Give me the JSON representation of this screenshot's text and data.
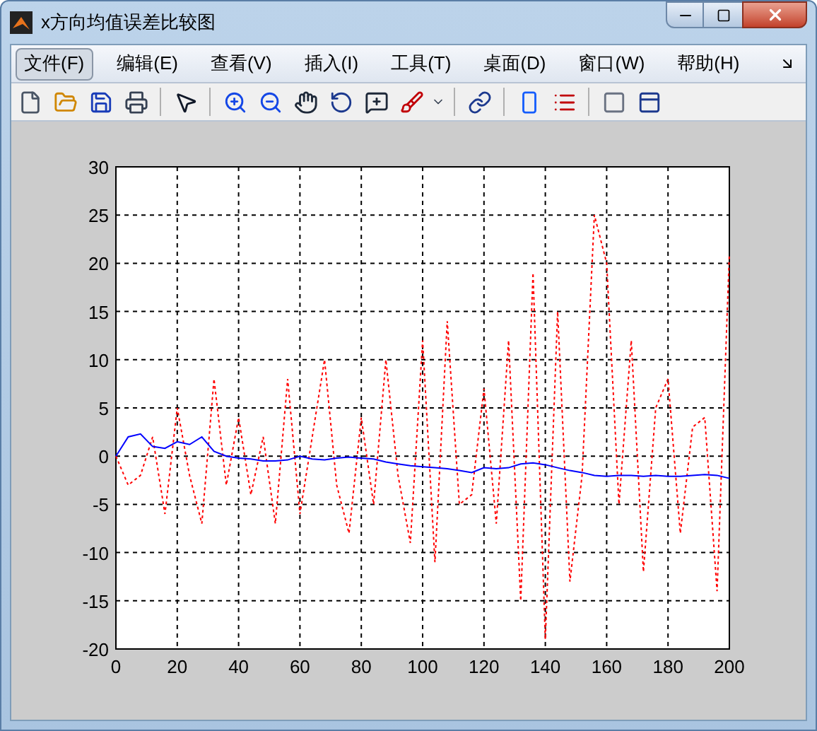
{
  "window": {
    "title": "x方向均值误差比较图"
  },
  "menu": [
    {
      "label": "文件(F)",
      "selected": true
    },
    {
      "label": "编辑(E)",
      "selected": false
    },
    {
      "label": "查看(V)",
      "selected": false
    },
    {
      "label": "插入(I)",
      "selected": false
    },
    {
      "label": "工具(T)",
      "selected": false
    },
    {
      "label": "桌面(D)",
      "selected": false
    },
    {
      "label": "窗口(W)",
      "selected": false
    },
    {
      "label": "帮助(H)",
      "selected": false
    }
  ],
  "figure": {
    "chart_data": {
      "type": "line",
      "x": [
        0,
        4,
        8,
        12,
        16,
        20,
        24,
        28,
        32,
        36,
        40,
        44,
        48,
        52,
        56,
        60,
        64,
        68,
        72,
        76,
        80,
        84,
        88,
        92,
        96,
        100,
        104,
        108,
        112,
        116,
        120,
        124,
        128,
        132,
        136,
        140,
        144,
        148,
        152,
        156,
        160,
        164,
        168,
        172,
        176,
        180,
        184,
        188,
        192,
        196,
        200
      ],
      "series": [
        {
          "color": "#ff0000",
          "line_style": "dotted",
          "values": [
            0,
            -3,
            -2,
            2,
            -6,
            5,
            -2,
            -7,
            8,
            -3,
            4,
            -4,
            2,
            -7,
            8,
            -6,
            2,
            10,
            -3,
            -8,
            4,
            -5,
            10,
            -2,
            -9,
            12,
            -11,
            14,
            -5,
            -4,
            7,
            -7,
            12,
            -15,
            19,
            -19,
            15,
            -13,
            -2,
            25,
            20,
            -5,
            12,
            -12,
            5,
            8,
            -8,
            3,
            4,
            -14,
            21
          ]
        },
        {
          "color": "#0000ff",
          "line_style": "solid",
          "values": [
            0,
            2,
            2.3,
            1,
            0.8,
            1.5,
            1.2,
            2,
            0.5,
            0,
            -0.2,
            -0.3,
            -0.5,
            -0.5,
            -0.4,
            0,
            -0.3,
            -0.4,
            -0.2,
            -0.1,
            -0.2,
            -0.3,
            -0.6,
            -0.8,
            -1.0,
            -1.1,
            -1.2,
            -1.3,
            -1.5,
            -1.7,
            -1.2,
            -1.3,
            -1.2,
            -0.8,
            -0.7,
            -0.9,
            -1.2,
            -1.5,
            -1.7,
            -2,
            -2.1,
            -2,
            -2,
            -2.1,
            -2,
            -2.1,
            -2.1,
            -2,
            -1.9,
            -2,
            -2.3
          ]
        }
      ],
      "grid": true,
      "xlim": [
        0,
        200
      ],
      "ylim": [
        -20,
        30
      ],
      "xticks": [
        0,
        20,
        40,
        60,
        80,
        100,
        120,
        140,
        160,
        180,
        200
      ],
      "yticks": [
        -20,
        -15,
        -10,
        -5,
        0,
        5,
        10,
        15,
        20,
        25,
        30
      ]
    }
  }
}
